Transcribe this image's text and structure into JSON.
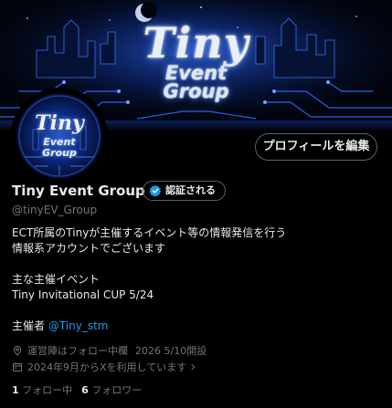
{
  "banner": {
    "title_line1": "Tiny",
    "title_line2": "Event",
    "title_line3": "Group"
  },
  "avatar": {
    "line1": "Tiny",
    "line2": "Event",
    "line3": "Group"
  },
  "edit_profile_label": "プロフィールを編集",
  "profile": {
    "display_name": "Tiny Event Group",
    "verify_label": "認証される",
    "handle": "@tinyEV_Group"
  },
  "bio": {
    "line1": "ECT所属のTinyが主催するイベント等の情報発信を行う",
    "line2": "情報系アカウントでございます",
    "line3": "主な主催イベント",
    "line4": "Tiny Invitational CUP 5/24",
    "line5_prefix": "主催者 ",
    "line5_mention": "@Tiny_stm"
  },
  "meta": {
    "location": "運営陣はフォロー中欄",
    "event": "2026 5/10開設",
    "joined": "2024年9月からXを利用しています"
  },
  "stats": {
    "following_count": "1",
    "following_label": "フォロー中",
    "followers_count": "6",
    "followers_label": "フォロワー"
  },
  "colors": {
    "background": "#000000",
    "text": "#e7e9ea",
    "secondary": "#71767b",
    "link": "#1d9bf0",
    "verified_badge": "#1d9bf0"
  },
  "icons": {
    "location": "location-icon",
    "calendar": "calendar-icon",
    "verified": "verified-badge-icon",
    "chevron": "chevron-right-icon"
  }
}
